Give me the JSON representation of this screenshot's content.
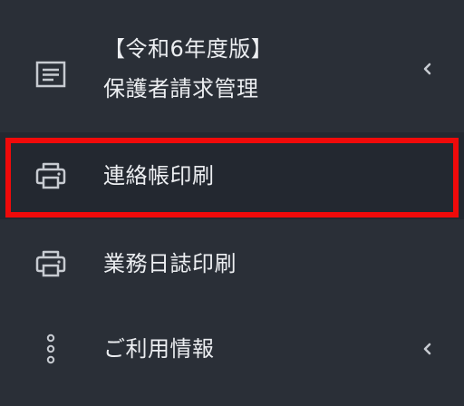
{
  "colors": {
    "background": "#2a2f37",
    "selected_background": "#232830",
    "highlight_border": "#f00a0a",
    "text": "#eceef1",
    "icon": "#c7cbd1"
  },
  "menu": {
    "items": [
      {
        "label_line1": "【令和6年度版】",
        "label_line2": "保護者請求管理",
        "icon": "document-icon",
        "has_submenu": true,
        "chevron": "chevron-left-icon"
      },
      {
        "label": "連絡帳印刷",
        "icon": "printer-icon",
        "selected": true
      },
      {
        "label": "業務日誌印刷",
        "icon": "printer-icon"
      },
      {
        "label": "ご利用情報",
        "icon": "more-vertical-icon",
        "has_submenu": true,
        "chevron": "chevron-left-icon"
      }
    ]
  }
}
